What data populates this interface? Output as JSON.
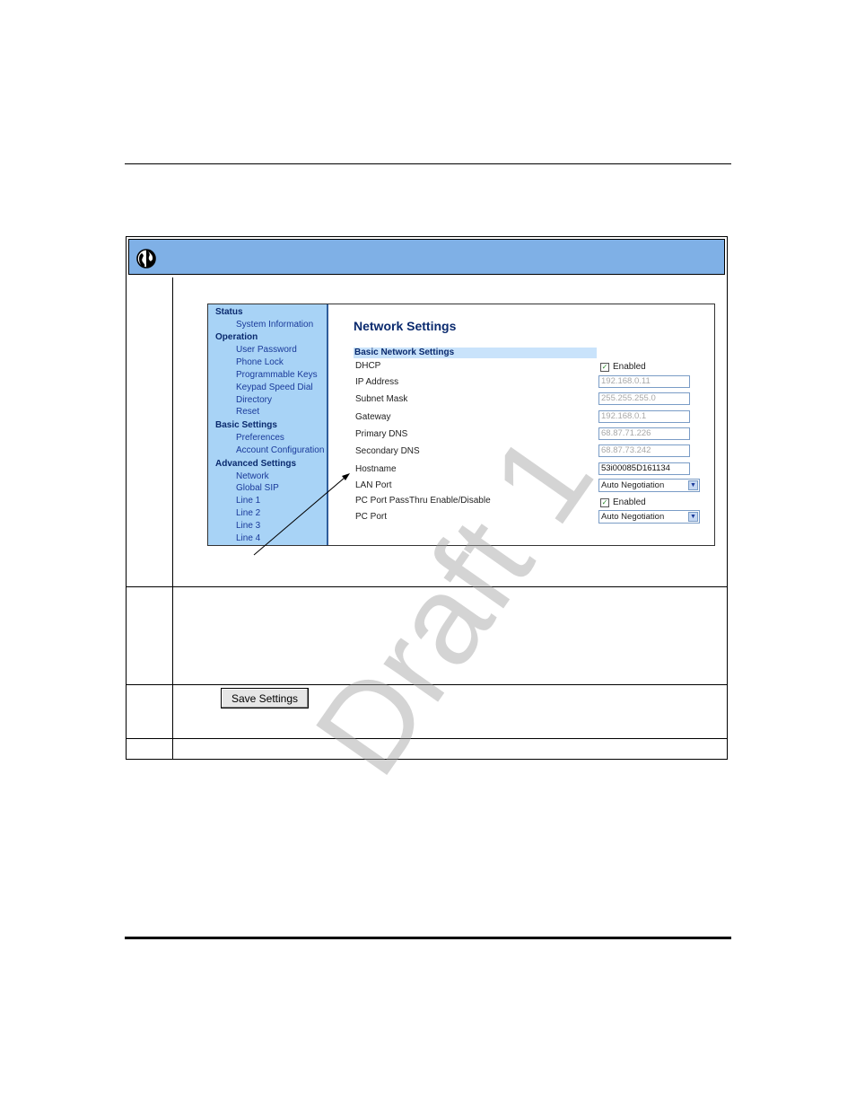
{
  "screenshot": {
    "nav": {
      "sections": [
        {
          "title": "Status",
          "items": [
            "System Information"
          ]
        },
        {
          "title": "Operation",
          "items": [
            "User Password",
            "Phone Lock",
            "Programmable Keys",
            "Keypad Speed Dial",
            "Directory",
            "Reset"
          ]
        },
        {
          "title": "Basic Settings",
          "items": [
            "Preferences",
            "Account Configuration"
          ]
        },
        {
          "title": "Advanced Settings",
          "items": [
            "Network",
            "Global SIP",
            "Line 1",
            "Line 2",
            "Line 3",
            "Line 4"
          ]
        }
      ]
    },
    "page_title": "Network Settings",
    "section_header": "Basic Network Settings",
    "fields": {
      "dhcp": {
        "label": "DHCP",
        "checked": true,
        "value": "Enabled"
      },
      "ip_address": {
        "label": "IP Address",
        "value": "192.168.0.11"
      },
      "subnet_mask": {
        "label": "Subnet Mask",
        "value": "255.255.255.0"
      },
      "gateway": {
        "label": "Gateway",
        "value": "192.168.0.1"
      },
      "primary_dns": {
        "label": "Primary DNS",
        "value": "68.87.71.226"
      },
      "secondary_dns": {
        "label": "Secondary DNS",
        "value": "68.87.73.242"
      },
      "hostname": {
        "label": "Hostname",
        "value": "53i00085D161134"
      },
      "lan_port": {
        "label": "LAN Port",
        "value": "Auto Negotiation"
      },
      "pc_port_passthru": {
        "label": "PC Port PassThru Enable/Disable",
        "checked": true,
        "value": "Enabled"
      },
      "pc_port": {
        "label": "PC Port",
        "value": "Auto Negotiation"
      }
    }
  },
  "save_button": "Save Settings",
  "watermark": "Draft 1",
  "colors": {
    "header_band": "#7fb0e6",
    "nav_bg": "#a8d3f6",
    "nav_text": "#1a3a9a"
  }
}
